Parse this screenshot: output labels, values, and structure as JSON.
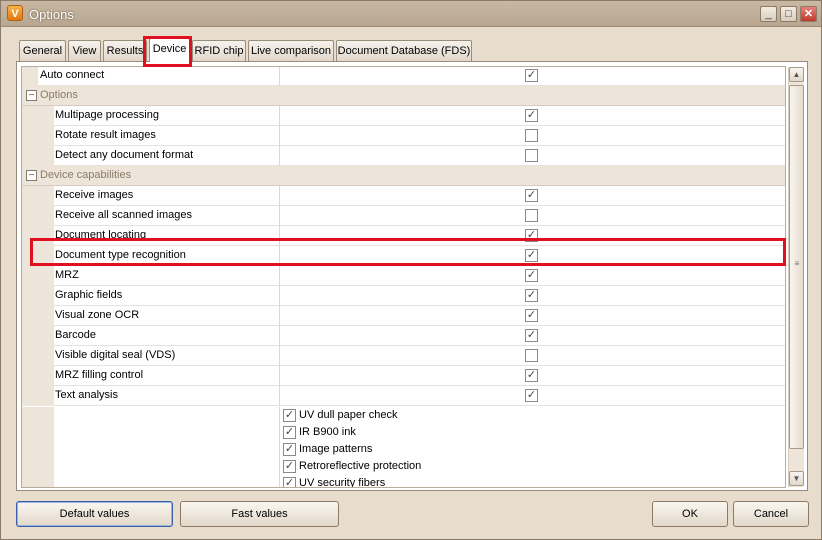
{
  "window": {
    "title": "Options",
    "icon": "app-logo-icon"
  },
  "tabs": [
    {
      "label": "General"
    },
    {
      "label": "View"
    },
    {
      "label": "Results"
    },
    {
      "label": "Device",
      "active": true
    },
    {
      "label": "RFID chip"
    },
    {
      "label": "Live comparison"
    },
    {
      "label": "Document Database (FDS)"
    }
  ],
  "rows": [
    {
      "label": "Auto connect",
      "type": "item",
      "checked": true,
      "indent": 0
    },
    {
      "label": "Options",
      "type": "category"
    },
    {
      "label": "Multipage processing",
      "type": "item",
      "checked": true,
      "indent": 1
    },
    {
      "label": "Rotate result images",
      "type": "item",
      "checked": false,
      "indent": 1
    },
    {
      "label": "Detect any document format",
      "type": "item",
      "checked": false,
      "indent": 1
    },
    {
      "label": "Device capabilities",
      "type": "category"
    },
    {
      "label": "Receive images",
      "type": "item",
      "checked": true,
      "indent": 1
    },
    {
      "label": "Receive all scanned images",
      "type": "item",
      "checked": false,
      "indent": 1
    },
    {
      "label": "Document locating",
      "type": "item",
      "checked": true,
      "indent": 1
    },
    {
      "label": "Document type recognition",
      "type": "item",
      "checked": true,
      "indent": 1
    },
    {
      "label": "MRZ",
      "type": "item",
      "checked": true,
      "indent": 1
    },
    {
      "label": "Graphic fields",
      "type": "item",
      "checked": true,
      "indent": 1
    },
    {
      "label": "Visual zone OCR",
      "type": "item",
      "checked": true,
      "indent": 1
    },
    {
      "label": "Barcode",
      "type": "item",
      "checked": true,
      "indent": 1
    },
    {
      "label": "Visible digital seal (VDS)",
      "type": "item",
      "checked": false,
      "indent": 1
    },
    {
      "label": "MRZ filling control",
      "type": "item",
      "checked": true,
      "indent": 1
    },
    {
      "label": "Text analysis",
      "type": "item",
      "checked": true,
      "indent": 1
    }
  ],
  "authenticity_checks": [
    {
      "label": "UV dull paper check",
      "checked": true
    },
    {
      "label": "IR B900 ink",
      "checked": true
    },
    {
      "label": "Image patterns",
      "checked": true
    },
    {
      "label": "Retroreflective protection",
      "checked": true
    },
    {
      "label": "UV security fibers",
      "checked": true
    }
  ],
  "buttons": {
    "default_values": "Default values",
    "fast_values": "Fast values",
    "ok": "OK",
    "cancel": "Cancel"
  },
  "glyphs": {
    "check": "✓",
    "minus": "−",
    "minimize": "_",
    "maximize": "□",
    "close": "✕",
    "up": "▲",
    "down": "▼",
    "grip": "≡",
    "app": "V"
  },
  "colors": {
    "highlight": "#e01020",
    "category_text": "#8a7a68",
    "title_bar": "#b8a690"
  }
}
